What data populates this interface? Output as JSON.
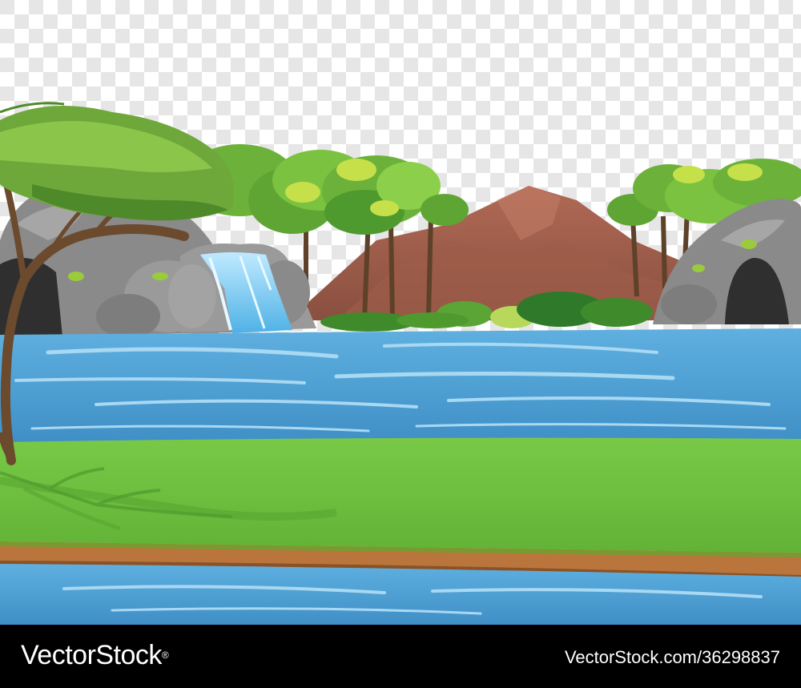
{
  "illustration": {
    "subject": "cartoon-nature-landscape",
    "background": "transparency-checkerboard",
    "colors": {
      "water": "#4a9fd3",
      "grass": "#6fc23f",
      "mountain": "#9a5a4a",
      "rock": "#8c8c8c",
      "foliage": "#6cb23a",
      "trunk": "#6b4a2e"
    }
  },
  "watermark": {
    "brand": "VectorStock",
    "registered_mark": "®",
    "image_id": "VectorStock.com/36298837"
  }
}
